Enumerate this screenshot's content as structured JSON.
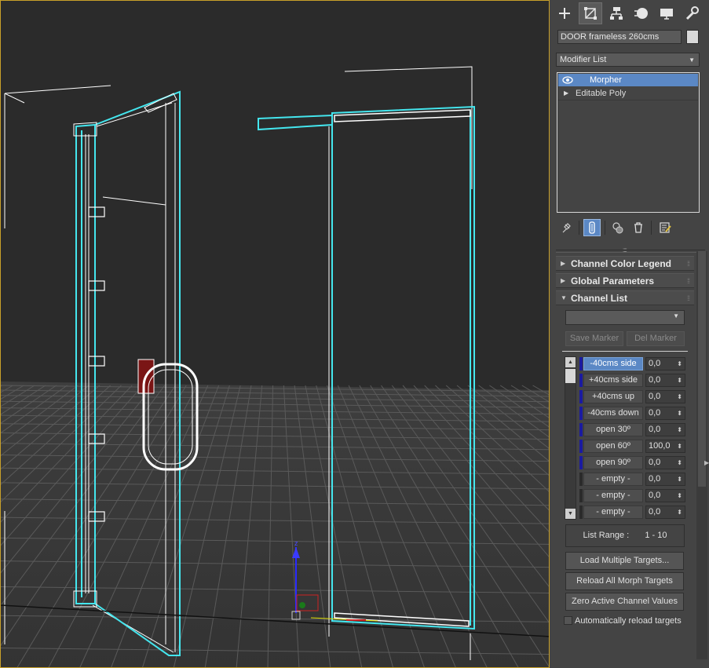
{
  "command_panel": {
    "tabs": [
      {
        "name": "create-tab",
        "icon": "plus-icon"
      },
      {
        "name": "modify-tab",
        "icon": "modify-icon",
        "active": true
      },
      {
        "name": "hierarchy-tab",
        "icon": "hierarchy-icon"
      },
      {
        "name": "motion-tab",
        "icon": "motion-icon"
      },
      {
        "name": "display-tab",
        "icon": "display-icon"
      },
      {
        "name": "utilities-tab",
        "icon": "wrench-icon"
      }
    ],
    "object_name": "DOOR frameless 260cms",
    "object_color": "#d8d8d8",
    "modifier_list_label": "Modifier List",
    "stack": [
      {
        "label": "Morpher",
        "selected": true
      },
      {
        "label": "Editable Poly",
        "selected": false
      }
    ],
    "rollouts": {
      "color_legend": "Channel Color Legend",
      "global_params": "Global Parameters",
      "channel_list": "Channel List"
    },
    "save_marker": "Save Marker",
    "del_marker": "Del Marker",
    "channels": [
      {
        "name": "-40cms side",
        "value": "0,0",
        "color": "#1a1aa0",
        "selected": true
      },
      {
        "name": "+40cms side",
        "value": "0,0",
        "color": "#1a1aa0",
        "selected": false
      },
      {
        "name": "+40cms up",
        "value": "0,0",
        "color": "#1a1aa0",
        "selected": false
      },
      {
        "name": "-40cms down",
        "value": "0,0",
        "color": "#1a1aa0",
        "selected": false
      },
      {
        "name": "open 30º",
        "value": "0,0",
        "color": "#1a1aa0",
        "selected": false
      },
      {
        "name": "open 60º",
        "value": "100,0",
        "color": "#1a1aa0",
        "selected": false
      },
      {
        "name": "open 90º",
        "value": "0,0",
        "color": "#1a1aa0",
        "selected": false
      },
      {
        "name": "- empty -",
        "value": "0,0",
        "color": "#2a2a2a",
        "selected": false
      },
      {
        "name": "- empty -",
        "value": "0,0",
        "color": "#2a2a2a",
        "selected": false
      },
      {
        "name": "- empty -",
        "value": "0,0",
        "color": "#2a2a2a",
        "selected": false
      }
    ],
    "list_range_label": "List Range :",
    "list_range_value": "1 - 10",
    "buttons": {
      "load_multiple": "Load Multiple Targets...",
      "reload_all": "Reload All Morph Targets",
      "zero_active": "Zero Active Channel Values"
    },
    "auto_reload_label": "Automatically reload targets",
    "auto_reload_checked": false
  },
  "viewport": {
    "border_color": "#c8a02a",
    "selection_color": "#44e6ee",
    "axis_label_z": "z"
  }
}
